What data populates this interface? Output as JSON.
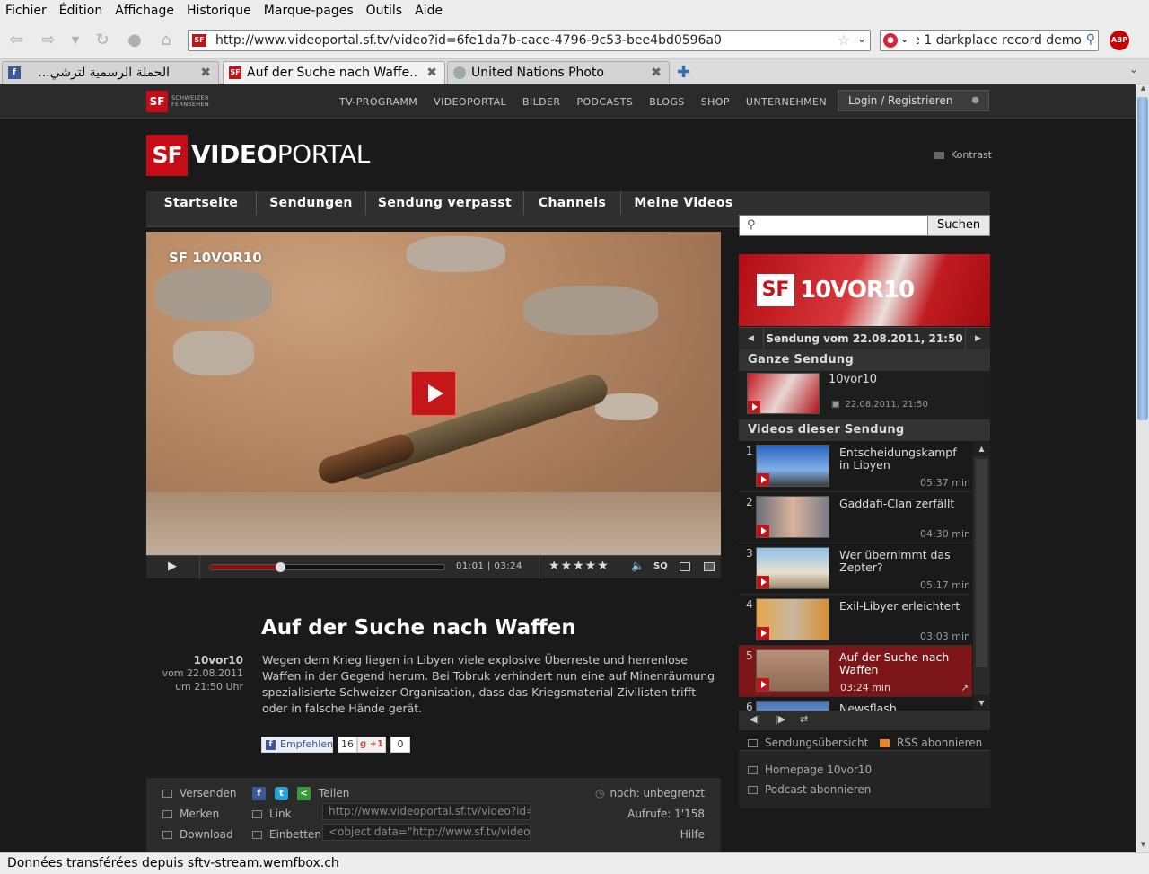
{
  "menu": [
    "Fichier",
    "Édition",
    "Affichage",
    "Historique",
    "Marque-pages",
    "Outils",
    "Aide"
  ],
  "nav": {
    "url": "http://www.videoportal.sf.tv/video?id=6fe1da7b-cace-4796-9c53-bee4bd0596a0",
    "search_text": "ke 1 darkplace record demo",
    "abp": "ABP"
  },
  "tabs": [
    {
      "label": "الحملة الرسمية لترشي...",
      "active": false
    },
    {
      "label": "Auf der Suche nach Waffe...",
      "active": true
    },
    {
      "label": "United Nations Photo",
      "active": false
    }
  ],
  "site": {
    "small_logo": "SF",
    "small_logo_text": "SCHWEIZER FERNSEHEN",
    "topnav": [
      "TV-PROGRAMM",
      "VIDEOPORTAL",
      "BILDER",
      "PODCASTS",
      "BLOGS",
      "SHOP",
      "UNTERNEHMEN"
    ],
    "login": "Login / Registrieren",
    "logo_sf": "SF",
    "logo_video": "VIDEO",
    "logo_portal": "PORTAL",
    "kontrast": "Kontrast",
    "mainnav": [
      "Startseite",
      "Sendungen",
      "Sendung verpasst",
      "Channels",
      "Meine Videos"
    ],
    "search_button": "Suchen"
  },
  "player": {
    "watermark": "SF 10VOR10",
    "time": "01:01 | 03:24",
    "progress": 0.299,
    "stars": "★★★★★",
    "sq": "SQ"
  },
  "article": {
    "title": "Auf der Suche nach Waffen",
    "show": "10vor10",
    "date": "vom 22.08.2011",
    "time": "um 21:50 Uhr",
    "text": "Wegen dem Krieg liegen in Libyen viele explosive Überreste und herrenlose Waffen in der Gegend herum. Bei Tobruk  verhindert nun eine auf Minenräumung spezialisierte Schweizer Organisation, dass das Kriegsmaterial Zivilisten trifft oder in falsche Hände gerät.",
    "fb_label": "Empfehlen",
    "fb_count": "16",
    "gplus_label": "+1",
    "gplus_count": "0"
  },
  "actions": {
    "versenden": "Versenden",
    "merken": "Merken",
    "download": "Download",
    "teilen": "Teilen",
    "link": "Link",
    "einbetten": "Einbetten",
    "link_value": "http://www.videoportal.sf.tv/video?id=",
    "embed_value": "<object data=\"http://www.sf.tv/video",
    "noch": "noch: unbegrenzt",
    "aufrufe": "Aufrufe: 1'158",
    "hilfe": "Hilfe"
  },
  "sidebar": {
    "banner_sf": "SF",
    "banner_show": "10VOR10",
    "date_label": "Sendung vom 22.08.2011, 21:50",
    "ganze_head": "Ganze Sendung",
    "ganze_title": "10vor10",
    "ganze_date": "22.08.2011, 21:50",
    "list_head": "Videos dieser Sendung",
    "videos": [
      {
        "num": "1",
        "title": "Entscheidungskampf in Libyen",
        "dur": "05:37 min"
      },
      {
        "num": "2",
        "title": "Gaddafi-Clan zerfällt",
        "dur": "04:30 min"
      },
      {
        "num": "3",
        "title": "Wer übernimmt das Zepter?",
        "dur": "05:17 min"
      },
      {
        "num": "4",
        "title": "Exil-Libyer erleichtert",
        "dur": "03:03 min"
      },
      {
        "num": "5",
        "title": "Auf der Suche nach Waffen",
        "dur": "03:24 min"
      },
      {
        "num": "6",
        "title": "Newsflash",
        "dur": ""
      }
    ],
    "sendungsuebersicht": "Sendungsübersicht",
    "rss": "RSS abonnieren",
    "homepage": "Homepage 10vor10",
    "podcast": "Podcast abonnieren"
  },
  "status": "Données transférées depuis sftv-stream.wemfbox.ch"
}
